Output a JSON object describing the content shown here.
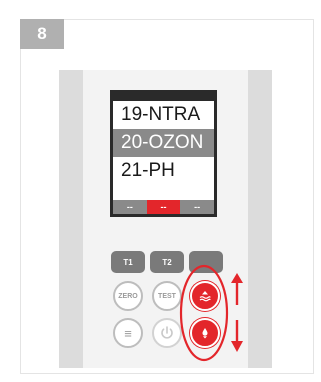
{
  "step": {
    "number": "8"
  },
  "screen": {
    "menu_items": [
      {
        "label": "19-NTRA",
        "selected": false
      },
      {
        "label": "20-OZON",
        "selected": true
      },
      {
        "label": "21-PH",
        "selected": false
      }
    ],
    "softkeys": [
      "--",
      "--",
      "--"
    ]
  },
  "buttons": {
    "t1": "T1",
    "t2": "T2",
    "zero": "ZERO",
    "test": "TEST",
    "menu_glyph": "≡"
  },
  "colors": {
    "accent": "#e3262b",
    "badge": "#b0b0b0",
    "display": "#2a2a2a",
    "button_gray": "#7a7a7a"
  }
}
